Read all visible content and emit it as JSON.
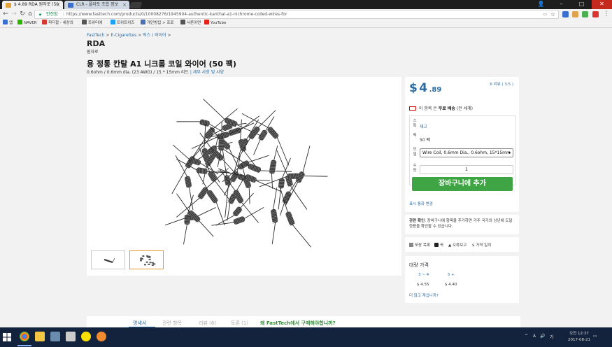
{
  "browser": {
    "tabs": [
      {
        "title": "$ 4.89 RDA 원자로 (50 ",
        "active": true
      },
      {
        "title": "CLR - 플라토 조합 정보",
        "active": false
      }
    ],
    "window_controls": {
      "user": "👤",
      "minimize": "–",
      "maximize": "□",
      "close": "✕"
    },
    "address": {
      "security": "안전함",
      "url": "https://www.fasttech.com/products/0/10008276/1945904-authentic-kanthal-a1-nichrome-coiled-wires-for"
    },
    "bookmarks": [
      {
        "label": "앱",
        "color": "#3b6fcf"
      },
      {
        "label": "NAVER",
        "color": "#2db400"
      },
      {
        "label": "피디팝 - 세상의",
        "color": "#d43a2f"
      },
      {
        "label": "트위터에",
        "color": "#555555"
      },
      {
        "label": "트위트위즈",
        "color": "#1da1f2"
      },
      {
        "label": "개인방립 > 프로",
        "color": "#4a6fb5"
      },
      {
        "label": "서른이면",
        "color": "#555555"
      },
      {
        "label": "YouTube",
        "color": "#e62117"
      }
    ]
  },
  "breadcrumb": {
    "items": [
      "FastTech",
      "E-Cigarettes",
      "릭스 / 와이어"
    ],
    "sep": ">"
  },
  "product": {
    "category": "RDA",
    "subcategory": "원자로",
    "title": "용 정통 칸탈 A1 니크롬 코일 와이어 (50 팩)",
    "spec": "0.6ohm / 0.6mm dia. (23 AWG) / 15 * 15mm 리드",
    "detail_link": "| 세부 사항 및 사양",
    "thumbnails": [
      "thumb-1",
      "thumb-2"
    ]
  },
  "purchase": {
    "currency_symbol": "$",
    "price_main": "4",
    "price_cents": ".89",
    "rating": "6 리뷰 ( 3.5 )",
    "free_shipping_prefix": "이 항목 은",
    "free_shipping_bold": "무료 배송",
    "free_shipping_suffix": "(전 세계)",
    "options": [
      {
        "label": "스톡",
        "value": "재고",
        "type": "text"
      },
      {
        "label": "팩",
        "value": "50 팩",
        "type": "text"
      },
      {
        "label": "모델",
        "value": "Wire Coil, 0.6mm Dia., 0.6ohm, 15*15mm",
        "type": "select"
      },
      {
        "label": "수량",
        "value": "1",
        "type": "qty"
      }
    ],
    "add_to_cart": "장바구니에 추가",
    "currency_change": "표시 통화 변경"
  },
  "notice": {
    "label": "관련 확인",
    "text": ": 장바구니에 항목을 추가하면 거주 국가의 상년에 도달한용을 확인할 수 있습니다."
  },
  "social": {
    "items": [
      "포장 목록",
      "꼭",
      "오류보고",
      "가격 일치"
    ]
  },
  "bulk": {
    "heading": "대량 가격",
    "tiers": [
      {
        "range": "3 ~ 4",
        "price": "$ 4.55"
      },
      {
        "range": "5 +",
        "price": "$ 4.40"
      }
    ],
    "more": "더 많고 계십니까?"
  },
  "bottom_tabs": [
    {
      "label": "명세서",
      "state": "on"
    },
    {
      "label": "관련 항목",
      "state": "off"
    },
    {
      "label": "리뷰 (6)",
      "state": "off"
    },
    {
      "label": "토론 (1)",
      "state": "off"
    },
    {
      "label": "왜 FastTech에서 구매해야합니까?",
      "state": "green"
    }
  ],
  "taskbar": {
    "tray": {
      "lang": "A",
      "volume": "🔊",
      "ime": "가"
    },
    "clock": {
      "time": "오전 12:37",
      "date": "2017-08-21"
    }
  },
  "colors": {
    "link": "#2b6ca3",
    "cart": "#3fa443",
    "taskbar": "#14233d",
    "tab_strip": "#1e1e1e"
  }
}
